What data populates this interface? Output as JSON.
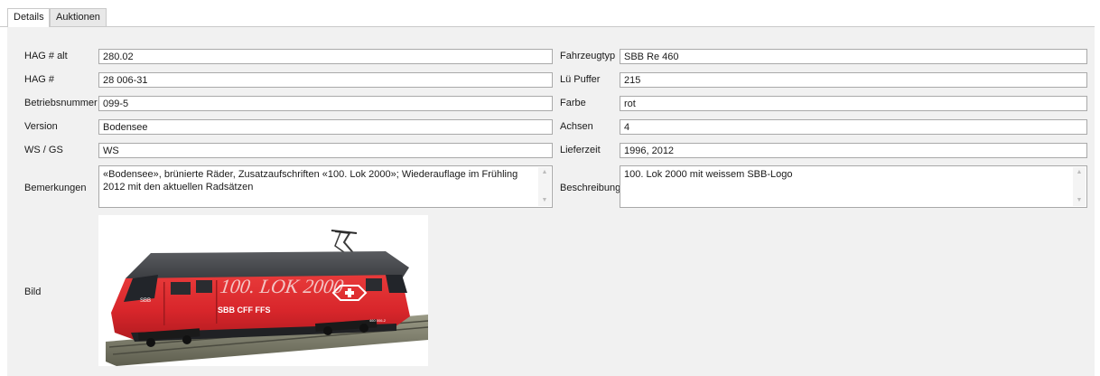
{
  "tabs": [
    {
      "label": "Details",
      "active": true
    },
    {
      "label": "Auktionen",
      "active": false
    }
  ],
  "left": {
    "hag_alt": {
      "label": "HAG # alt",
      "value": "280.02"
    },
    "hag": {
      "label": "HAG #",
      "value": "28 006-31"
    },
    "betriebsnummer": {
      "label": "Betriebsnummer",
      "value": "099-5"
    },
    "version": {
      "label": "Version",
      "value": "Bodensee"
    },
    "ws_gs": {
      "label": "WS / GS",
      "value": "WS"
    },
    "bemerkungen": {
      "label": "Bemerkungen",
      "value": "«Bodensee», brünierte Räder, Zusatzaufschriften «100. Lok 2000»; Wiederauflage im Frühling 2012 mit den aktuellen Radsätzen"
    },
    "bild": {
      "label": "Bild"
    }
  },
  "right": {
    "fahrzeugtyp": {
      "label": "Fahrzeugtyp",
      "value": "SBB Re 460"
    },
    "lue_puffer": {
      "label": "Lü Puffer",
      "value": "215"
    },
    "farbe": {
      "label": "Farbe",
      "value": "rot"
    },
    "achsen": {
      "label": "Achsen",
      "value": "4"
    },
    "lieferzeit": {
      "label": "Lieferzeit",
      "value": "1996, 2012"
    },
    "beschreibung": {
      "label": "Beschreibung",
      "value": "100. Lok 2000 mit weissem SBB-Logo"
    }
  },
  "photo": {
    "icon": "locomotive-photo",
    "lettering": "100. LOK 2000",
    "operator_text": "SBB CFF FFS",
    "number_text": "460 006-2",
    "colors": {
      "body": "#d8262b",
      "roof": "#3d3f43",
      "lettering": "#f3c5c4"
    }
  }
}
